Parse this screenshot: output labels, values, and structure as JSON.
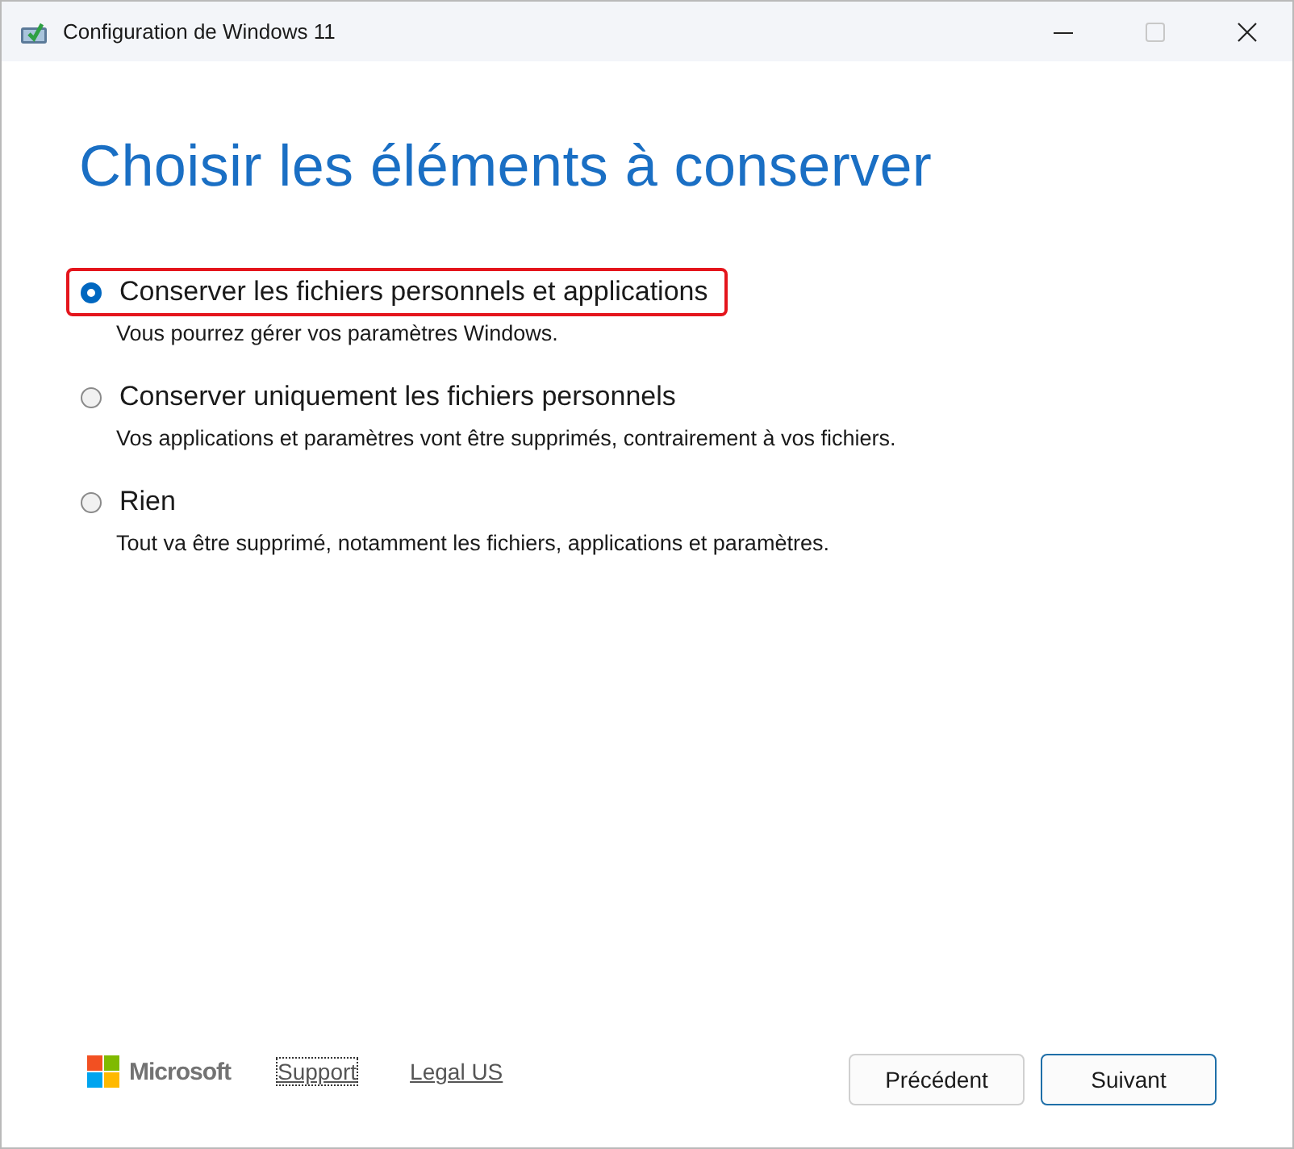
{
  "window": {
    "title": "Configuration de Windows 11"
  },
  "heading": "Choisir les éléments à conserver",
  "options": [
    {
      "label": "Conserver les fichiers personnels et applications",
      "description": "Vous pourrez gérer vos paramètres Windows.",
      "selected": true,
      "highlighted": true
    },
    {
      "label": "Conserver uniquement les fichiers personnels",
      "description": "Vos applications et paramètres vont être supprimés, contrairement à vos fichiers.",
      "selected": false,
      "highlighted": false
    },
    {
      "label": "Rien",
      "description": "Tout va être supprimé, notamment les fichiers, applications et paramètres.",
      "selected": false,
      "highlighted": false
    }
  ],
  "footer": {
    "brand": "Microsoft",
    "links": [
      {
        "label": "Support",
        "focused": true
      },
      {
        "label": "Legal US",
        "focused": false
      }
    ],
    "buttons": [
      {
        "label": "Précédent",
        "default": false
      },
      {
        "label": "Suivant",
        "default": true
      }
    ]
  }
}
